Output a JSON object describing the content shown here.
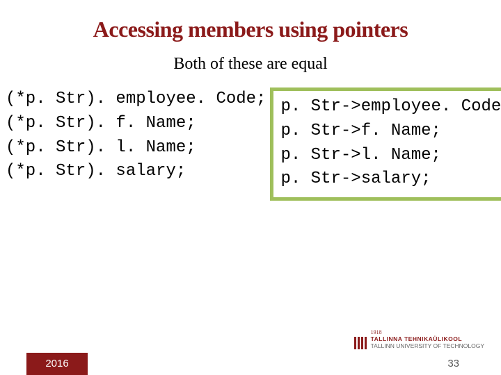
{
  "title": "Accessing members using pointers",
  "subtitle": "Both of these are equal",
  "code_left": "(*p. Str). employee. Code;\n(*p. Str). f. Name;\n(*p. Str). l. Name;\n(*p. Str). salary;",
  "code_right": "p. Str->employee. Code;\np. Str->f. Name;\np. Str->l. Name;\np. Str->salary;",
  "footer": {
    "year": "2016",
    "page": "33",
    "logo_year": "1918",
    "logo_est": "TALLINNA TEHNIKAÜLIKOOL",
    "logo_en": "TALLINN UNIVERSITY OF TECHNOLOGY"
  }
}
